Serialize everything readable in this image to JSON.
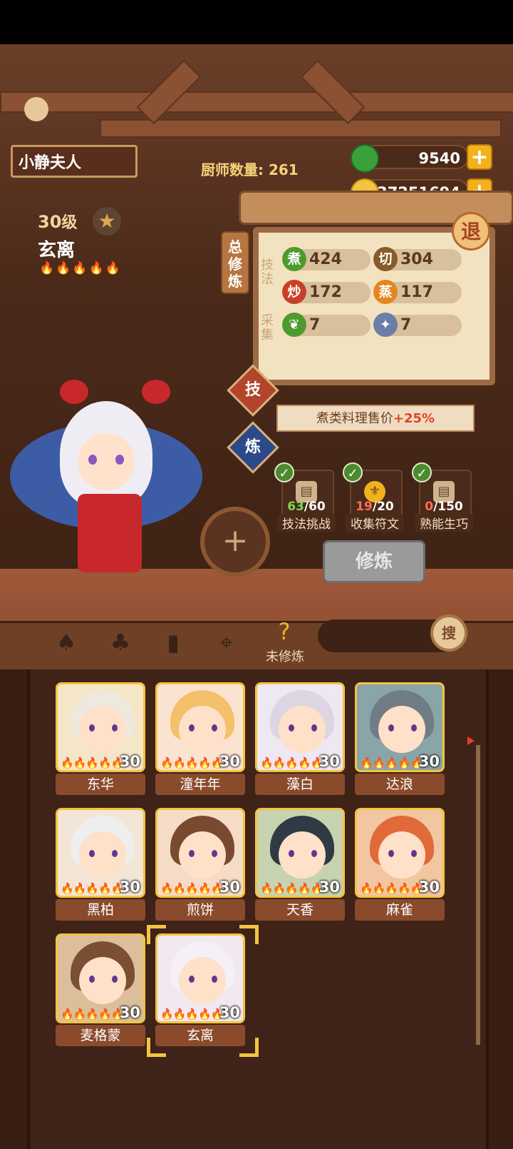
{
  "player": {
    "name": "小静夫人"
  },
  "chef_count": {
    "label": "厨师数量:",
    "value": "261"
  },
  "resources": {
    "jade": "9540",
    "coins": "37251694"
  },
  "character": {
    "level": "30",
    "level_unit": "级",
    "name": "玄离",
    "flames": "🔥🔥🔥🔥🔥"
  },
  "panel": {
    "vertical_tab": "总修炼",
    "skill_label": "技法",
    "gather_label": "采集",
    "stats": [
      {
        "badge": "煮",
        "value": "424",
        "color": "#4f9a2e"
      },
      {
        "badge": "切",
        "value": "304",
        "color": "#8a5a2a"
      },
      {
        "badge": "炒",
        "value": "172",
        "color": "#c8402a"
      },
      {
        "badge": "蒸",
        "value": "117",
        "color": "#e2861f"
      },
      {
        "badge": "",
        "value": "7",
        "color": "#4f9a2e",
        "icon": "vegetable-icon"
      },
      {
        "badge": "",
        "value": "7",
        "color": "#6a7ea8",
        "icon": "fish-icon"
      }
    ],
    "exit_label": "退"
  },
  "side_tabs": {
    "skill": "技",
    "train": "炼"
  },
  "bonus_banner": {
    "text": "煮类料理售价",
    "bonus": "+25%"
  },
  "tasks": [
    {
      "label": "技法挑战",
      "got": "63",
      "total": "/60"
    },
    {
      "label": "收集符文",
      "got": "19",
      "total": "/20"
    },
    {
      "label": "熟能生巧",
      "got": "0",
      "total": "/150"
    }
  ],
  "train_button": "修炼",
  "toolbar": {
    "active_label": "未修炼",
    "search_button": "搜"
  },
  "chefs": [
    {
      "name": "东华",
      "level": "30",
      "color": "#f6e6c8",
      "hair": "#efe8de"
    },
    {
      "name": "潼年年",
      "level": "30",
      "color": "#fbe3d2",
      "hair": "#f4c06a"
    },
    {
      "name": "藻白",
      "level": "30",
      "color": "#eee8f2",
      "hair": "#ddd6e2"
    },
    {
      "name": "达浪",
      "level": "30",
      "color": "#8aa5a8",
      "hair": "#707c86"
    },
    {
      "name": "黑柏",
      "level": "30",
      "color": "#f3e6d6",
      "hair": "#eeeeee"
    },
    {
      "name": "煎饼",
      "level": "30",
      "color": "#f6dcc6",
      "hair": "#7a4a30"
    },
    {
      "name": "天香",
      "level": "30",
      "color": "#c7d2b0",
      "hair": "#2f3a44"
    },
    {
      "name": "麻雀",
      "level": "30",
      "color": "#f2c6a0",
      "hair": "#e06a3a"
    },
    {
      "name": "麦格蒙",
      "level": "30",
      "color": "#dcbf9a",
      "hair": "#7a4f33"
    },
    {
      "name": "玄离",
      "level": "30",
      "color": "#f2e8f0",
      "hair": "#f4f0f6"
    }
  ],
  "chef_flames": "🔥🔥🔥🔥🔥"
}
